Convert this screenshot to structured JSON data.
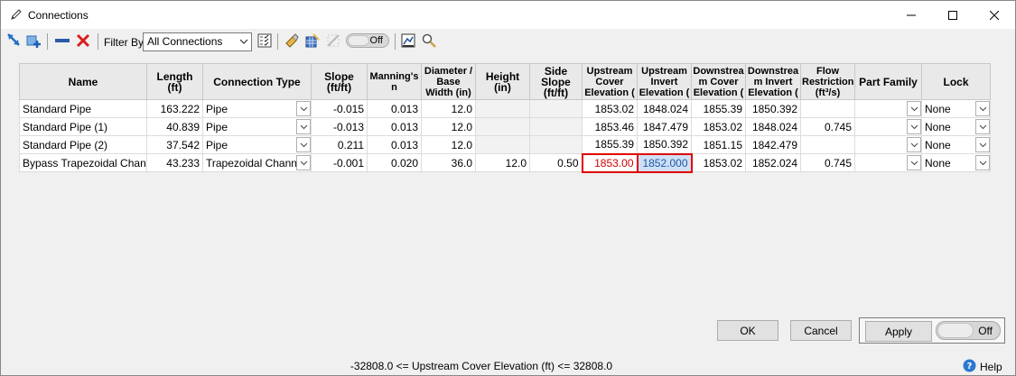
{
  "window": {
    "title": "Connections"
  },
  "toolbar": {
    "filter_label": "Filter By",
    "filter_value": "All Connections",
    "toggle_label": "Off"
  },
  "grid": {
    "columns": [
      "Name",
      "Length (ft)",
      "Connection Type",
      "Slope\n(ft/ft)",
      "Manning's\nn",
      "Diameter /\nBase\nWidth (in)",
      "Height (in)",
      "Side\nSlope\n(ft/ft)",
      "Upstream\nCover\nElevation (",
      "Upstream\nInvert\nElevation (",
      "Downstrea\nm Cover\nElevation (",
      "Downstrea\nm Invert\nElevation (",
      "Flow\nRestriction\n(ft³/s)",
      "Part Family",
      "Lock"
    ],
    "rows": [
      {
        "name": "Standard Pipe",
        "length": "163.222",
        "type": "Pipe",
        "slope": "-0.015",
        "manning": "0.013",
        "diameter": "12.0",
        "height": "",
        "side_slope": "",
        "up_cover": "1853.02",
        "up_invert": "1848.024",
        "down_cover": "1855.39",
        "down_invert": "1850.392",
        "flow": "",
        "part_family": "",
        "lock": "None"
      },
      {
        "name": "Standard Pipe (1)",
        "length": "40.839",
        "type": "Pipe",
        "slope": "-0.013",
        "manning": "0.013",
        "diameter": "12.0",
        "height": "",
        "side_slope": "",
        "up_cover": "1853.46",
        "up_invert": "1847.479",
        "down_cover": "1853.02",
        "down_invert": "1848.024",
        "flow": "0.745",
        "part_family": "",
        "lock": "None"
      },
      {
        "name": "Standard Pipe (2)",
        "length": "37.542",
        "type": "Pipe",
        "slope": "0.211",
        "manning": "0.013",
        "diameter": "12.0",
        "height": "",
        "side_slope": "",
        "up_cover": "1855.39",
        "up_invert": "1850.392",
        "down_cover": "1851.15",
        "down_invert": "1842.479",
        "flow": "",
        "part_family": "",
        "lock": "None"
      },
      {
        "name": "Bypass Trapezoidal Channel",
        "length": "43.233",
        "type": "Trapezoidal Channel",
        "slope": "-0.001",
        "manning": "0.020",
        "diameter": "36.0",
        "height": "12.0",
        "side_slope": "0.50",
        "up_cover": "1853.00",
        "up_invert": "1852.000",
        "down_cover": "1853.02",
        "down_invert": "1852.024",
        "flow": "0.745",
        "part_family": "",
        "lock": "None"
      }
    ]
  },
  "buttons": {
    "ok": "OK",
    "cancel": "Cancel",
    "apply": "Apply",
    "toggle_off": "Off",
    "help": "Help"
  },
  "status": "-32808.0 <= Upstream Cover Elevation (ft) <= 32808.0",
  "colors": {
    "selection_border": "#e00000",
    "invalid_text": "#d40000",
    "selected_cell": "#cfe0f5"
  }
}
